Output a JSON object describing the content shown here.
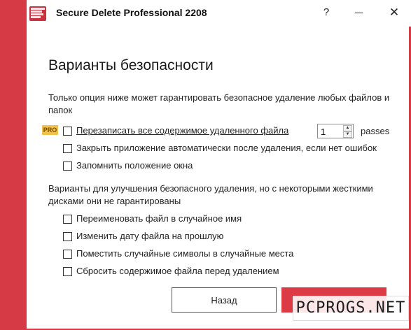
{
  "window": {
    "title": "Secure Delete Professional 2208",
    "help_label": "?",
    "minimize_icon": "minimize-icon",
    "close_label": "✕",
    "accent_color": "#d63a45"
  },
  "main": {
    "heading": "Варианты безопасности",
    "intro_text": "Только опция ниже может гарантировать безопасное удаление любых файлов и папок",
    "pro_badge": "PRO",
    "options_primary": [
      {
        "label": "Перезаписать все содержимое удаленного файла",
        "checked": false
      },
      {
        "label": "Закрыть приложение автоматически после удаления, если нет ошибок",
        "checked": false
      },
      {
        "label": "Запомнить положение окна",
        "checked": false
      }
    ],
    "passes": {
      "value": "1",
      "label": "passes"
    },
    "secondary_text": "Варианты для улучшения безопасного удаления, но с некоторыми жесткими дисками они не гарантированы",
    "options_secondary": [
      {
        "label": "Переименовать файл в случайное имя",
        "checked": false
      },
      {
        "label": "Изменить дату файла на прошлую",
        "checked": false
      },
      {
        "label": "Поместить случайные символы в случайные места",
        "checked": false
      },
      {
        "label": "Сбросить содержимое файла перед удалением",
        "checked": false
      }
    ]
  },
  "footer": {
    "back_label": "Назад",
    "delete_label": "Удалить"
  },
  "watermark": "PCPROGS.NET"
}
